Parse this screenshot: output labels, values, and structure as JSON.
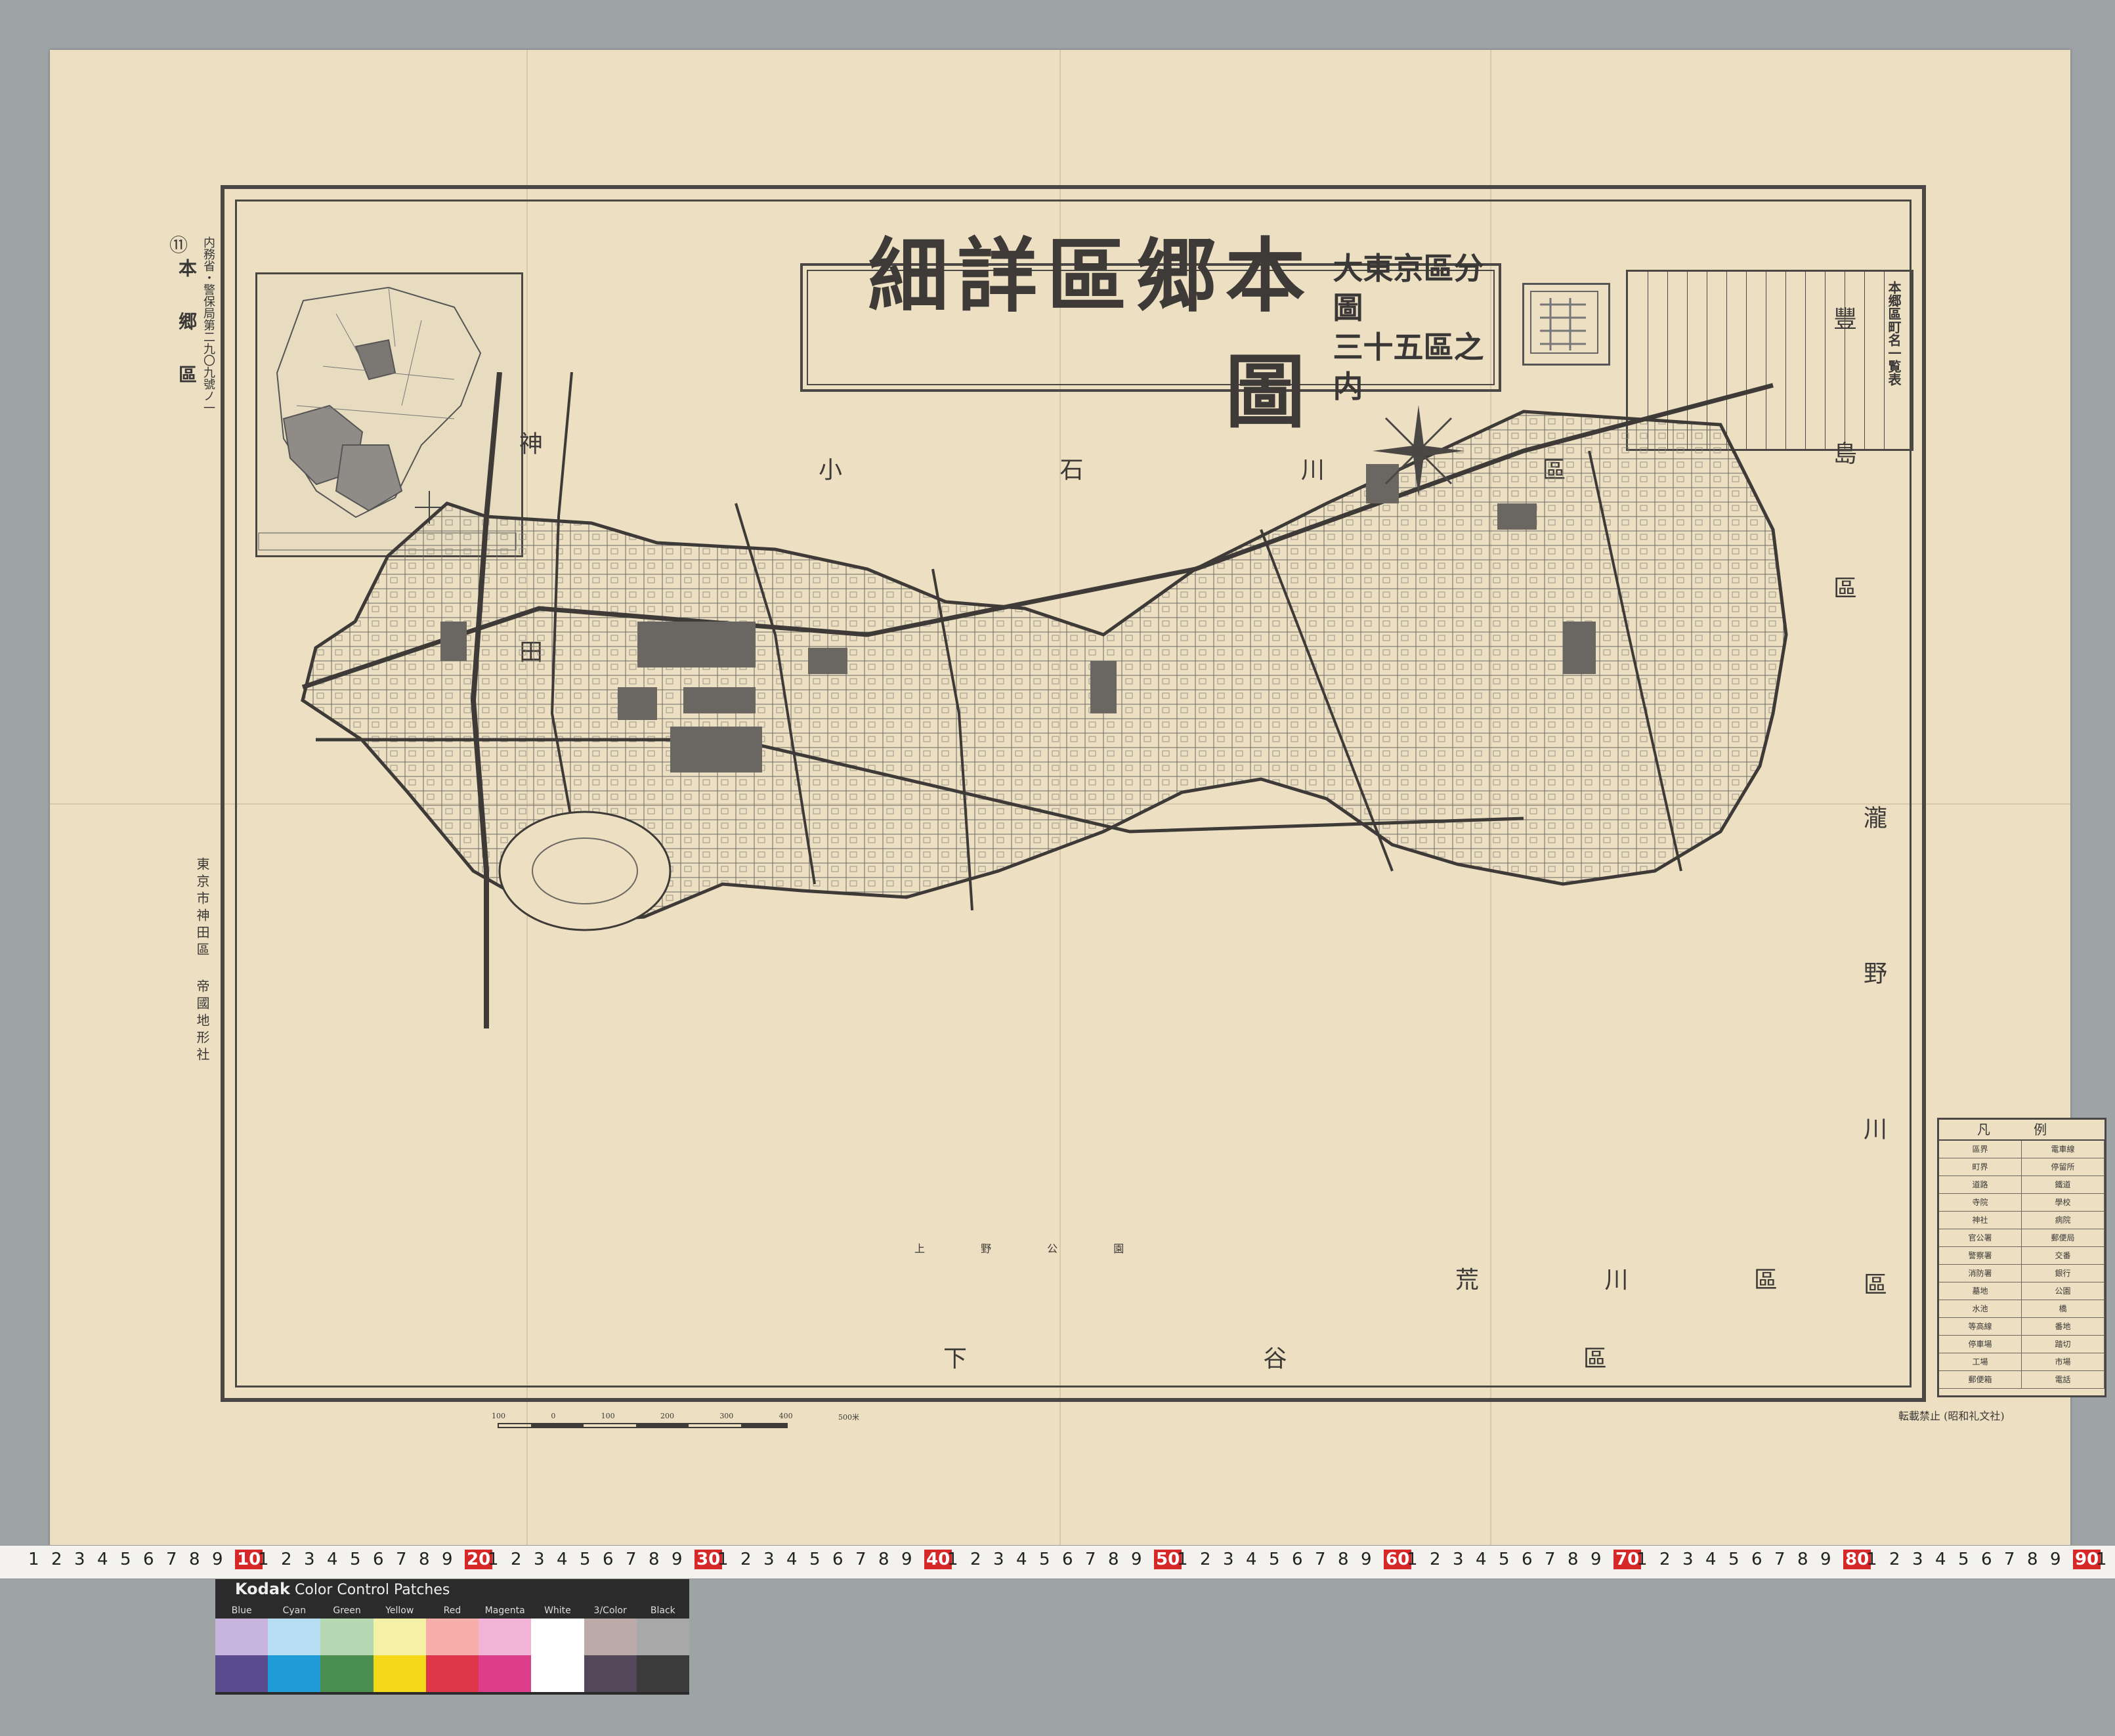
{
  "map": {
    "title": "本郷區詳細圖",
    "subtitle_line1": "大東京區分圖",
    "subtitle_line2": "三十五區之内",
    "sheet_number": "⑪",
    "ward_short": "本 郷 區",
    "registration": "内務省・警保局第二九〇九號ノ一",
    "ward_table_title": "本郷區町名一覧表",
    "legend_title": "凡 例",
    "publisher_line": "東京市神田區 帝國地形社",
    "bottom_credit": "転載禁止 (昭和礼文社)",
    "districts": {
      "koishikawa": "小 石 川 區",
      "kanda": "神 田 區",
      "toshima": "豐 島 區",
      "takinogawa": "瀧 野 川 區",
      "arakawa": "荒 川 區",
      "shitaya": "下 谷 區",
      "ueno_park": "上 野 公 園"
    },
    "legend_rows": [
      [
        "區界",
        "電車線"
      ],
      [
        "町界",
        "停留所"
      ],
      [
        "道路",
        "鐵道"
      ],
      [
        "寺院",
        "學校"
      ],
      [
        "神社",
        "病院"
      ],
      [
        "官公署",
        "郵便局"
      ],
      [
        "警察署",
        "交番"
      ],
      [
        "消防署",
        "銀行"
      ],
      [
        "墓地",
        "公園"
      ],
      [
        "水池",
        "橋"
      ],
      [
        "等高線",
        "番地"
      ],
      [
        "停車場",
        "踏切"
      ],
      [
        "工場",
        "市場"
      ],
      [
        "郵便箱",
        "電話"
      ]
    ],
    "scale_labels": [
      "100",
      "0",
      "100",
      "200",
      "300",
      "400",
      "500米"
    ]
  },
  "ruler": {
    "decades": [
      "10",
      "20",
      "30",
      "40",
      "50",
      "60",
      "70",
      "80",
      "90"
    ]
  },
  "color_patches": {
    "brand": "Kodak",
    "name": "Color Control Patches",
    "labels": [
      "Blue",
      "Cyan",
      "Green",
      "Yellow",
      "Red",
      "Magenta",
      "White",
      "3/Color",
      "Black"
    ],
    "light": [
      "#c8b6de",
      "#b6ddf2",
      "#b5d8b2",
      "#f4f0a6",
      "#f5aeaa",
      "#f2b4d6",
      "#ffffff",
      "#bcaaa8",
      "#a8a8a8"
    ],
    "dark": [
      "#5a4c8e",
      "#1f9bd7",
      "#4a8f4f",
      "#f4d91a",
      "#e0364a",
      "#dc3e8a",
      "#ffffff",
      "#55475a",
      "#3b3b3b"
    ]
  }
}
